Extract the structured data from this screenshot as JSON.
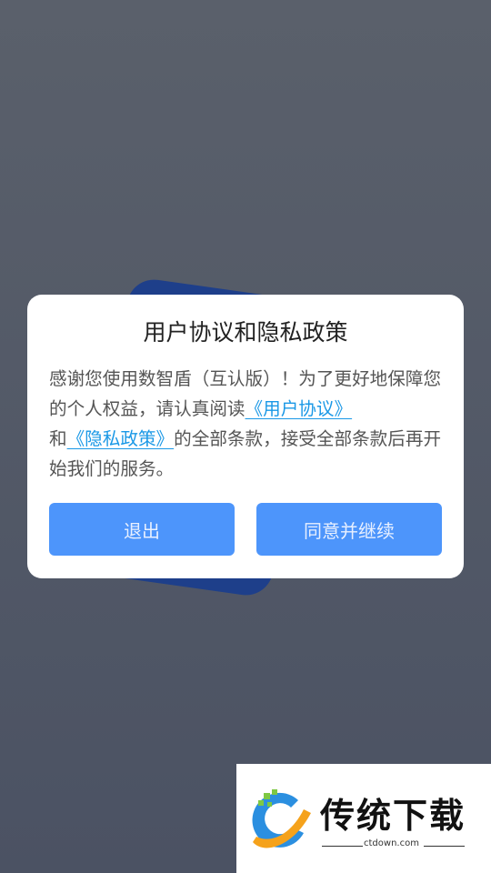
{
  "dialog": {
    "title": "用户协议和隐私政策",
    "text_part1": "感谢您使用数智盾（互认版）！为了更好地保障您的个人权益，请认真阅读",
    "link_user_agreement": "《用户协议》",
    "text_and": "和",
    "link_privacy_policy": "《隐私政策》",
    "text_part2": "的全部条款，接受全部条款后再开始我们的服务。",
    "exit_label": "退出",
    "agree_label": "同意并继续"
  },
  "watermark": {
    "name": "传统下载",
    "url": "ctdown.com"
  },
  "colors": {
    "accent_button": "#4d95fb",
    "link": "#1a98e6",
    "backdrop": "#535a66"
  }
}
